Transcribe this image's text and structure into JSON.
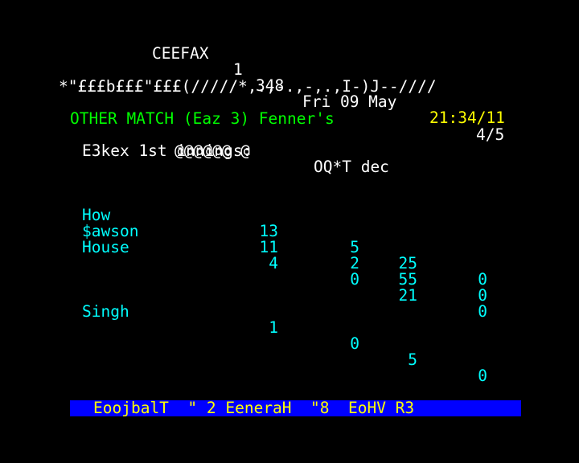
{
  "header": {
    "service": "CEEFAX",
    "channel": "1",
    "page_number": "348",
    "date": "Fri 09 May",
    "time": "21:34/11"
  },
  "garbled_line": "*\"£££b£££\"£££(/////*,.,-.,-,.,I-)J--////",
  "title": {
    "text": "OTHER MATCH (Eaz 3) Fenner's",
    "subpage": "4/5"
  },
  "innings": {
    "label": "E3kex 1st innings:",
    "total": "OQ*T dec",
    "noise": "@@@@@@ @"
  },
  "bowlers": [
    {
      "name": "How",
      "overs": "13",
      "maidens": "5",
      "runs": "25",
      "wickets": "0"
    },
    {
      "name": "$awson",
      "overs": "11",
      "maidens": "2",
      "runs": "55",
      "wickets": "0"
    },
    {
      "name": "House",
      "overs": "4",
      "maidens": "0",
      "runs": "21",
      "wickets": "0"
    },
    {
      "name": "Singh",
      "overs": "1",
      "maidens": "0",
      "runs": "5",
      "wickets": "0"
    }
  ],
  "footer": {
    "text": "EoojbalT  \" 2 EeneraH  \"8  EoHV R3"
  },
  "colors": {
    "background": "#000000",
    "header_text": "#ffffff",
    "clock": "#ffff00",
    "title": "#00ff00",
    "table": "#00ffff",
    "footer_bar": "#0000ff",
    "footer_text": "#ffff00"
  }
}
